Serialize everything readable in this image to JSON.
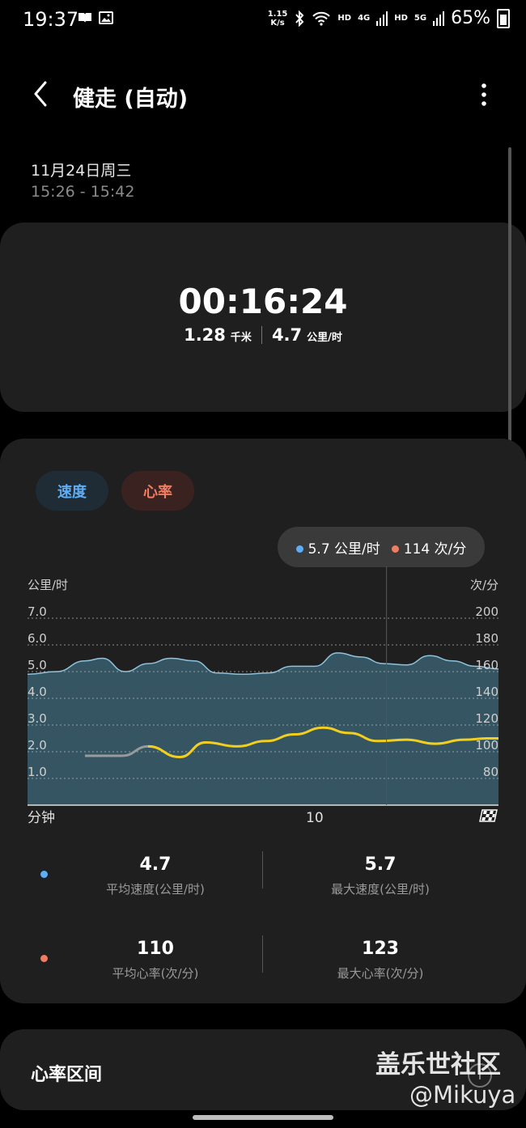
{
  "status_bar": {
    "time": "19:37",
    "net_speed_value": "1.15",
    "net_speed_unit": "K/s",
    "hd1": "HD",
    "net4g": "4G",
    "hd2": "HD",
    "net5g": "5G",
    "battery": "65%"
  },
  "header": {
    "title": "健走 (自动)"
  },
  "session": {
    "date": "11月24日周三",
    "time_range": "15:26 - 15:42"
  },
  "summary": {
    "duration": "00:16:24",
    "distance_value": "1.28",
    "distance_unit": "千米",
    "speed_value": "4.7",
    "speed_unit": "公里/时"
  },
  "chips": {
    "speed": "速度",
    "heart_rate": "心率"
  },
  "tooltip": {
    "speed": "5.7 公里/时",
    "heart_rate": "114 次/分"
  },
  "colors": {
    "speed": "#5eaef6",
    "heart_rate": "#ef7d62",
    "hr_line": "#f2cf1d",
    "area_fill": "#375966",
    "area_line": "#8fc3dc"
  },
  "chart_data": {
    "type": "area",
    "left_axis_label": "公里/时",
    "right_axis_label": "次/分",
    "x_label": "分钟",
    "x_ticks": [
      {
        "x": 10,
        "label": "10"
      }
    ],
    "xlim": [
      0,
      16.4
    ],
    "left_ticks": [
      "1.0",
      "2.0",
      "3.0",
      "4.0",
      "5.0",
      "6.0",
      "7.0"
    ],
    "left_ylim": [
      0,
      8
    ],
    "right_ticks": [
      "80",
      "100",
      "120",
      "140",
      "160",
      "180",
      "200"
    ],
    "right_ylim": [
      60,
      220
    ],
    "grid": true,
    "series": [
      {
        "name": "速度",
        "axis": "left",
        "x": [
          0,
          1,
          2,
          2.6,
          3.4,
          4.2,
          5.0,
          5.8,
          6.6,
          7.5,
          8.4,
          9.2,
          10.0,
          10.8,
          11.6,
          12.4,
          13.2,
          14.0,
          14.8,
          15.6,
          16.4
        ],
        "values": [
          4.9,
          5.0,
          5.4,
          5.5,
          5.0,
          5.3,
          5.5,
          5.4,
          4.95,
          4.9,
          4.95,
          5.2,
          5.2,
          5.7,
          5.55,
          5.3,
          5.25,
          5.6,
          5.4,
          5.2,
          5.1
        ]
      },
      {
        "name": "心率",
        "axis": "right",
        "x": [
          2.0,
          3.3,
          4.2,
          5.3,
          6.2,
          7.3,
          8.3,
          9.3,
          10.3,
          11.2,
          12.2,
          13.2,
          14.2,
          15.2,
          16.0,
          16.4
        ],
        "values": [
          97,
          97,
          104,
          96,
          107,
          104,
          108,
          113,
          118,
          114,
          108,
          109,
          106,
          109,
          110,
          110
        ]
      }
    ],
    "cursor_x": 12.5
  },
  "stats": {
    "avg_speed_value": "4.7",
    "avg_speed_label": "平均速度(公里/时)",
    "max_speed_value": "5.7",
    "max_speed_label": "最大速度(公里/时)",
    "avg_hr_value": "110",
    "avg_hr_label": "平均心率(次/分)",
    "max_hr_value": "123",
    "max_hr_label": "最大心率(次/分)"
  },
  "zones": {
    "title": "心率区间",
    "info_icon": "i"
  },
  "watermark": {
    "line1": "盖乐世社区",
    "line2": "@Mikuya"
  }
}
